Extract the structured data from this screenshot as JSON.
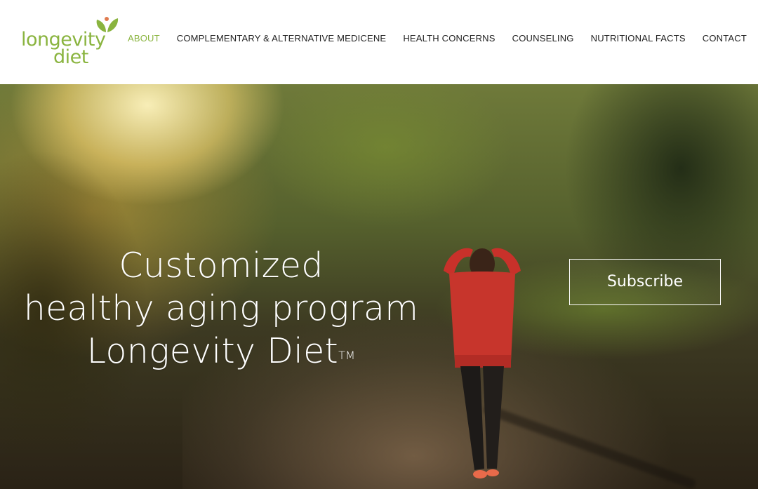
{
  "logo": {
    "line1": "longevity",
    "line2": "diet",
    "brand_color": "#8ab43f",
    "icon": "leaf-icon"
  },
  "nav": {
    "items": [
      {
        "label": "ABOUT",
        "active": true
      },
      {
        "label": "COMPLEMENTARY & ALTERNATIVE MEDICENE",
        "active": false
      },
      {
        "label": "HEALTH CONCERNS",
        "active": false
      },
      {
        "label": "COUNSELING",
        "active": false
      },
      {
        "label": "NUTRITIONAL FACTS",
        "active": false
      },
      {
        "label": "CONTACT",
        "active": false
      }
    ]
  },
  "hero": {
    "line1": "Customized",
    "line2": "healthy aging program",
    "line3": "Longevity Diet",
    "trademark": "TM",
    "subscribe_label": "Subscribe"
  }
}
